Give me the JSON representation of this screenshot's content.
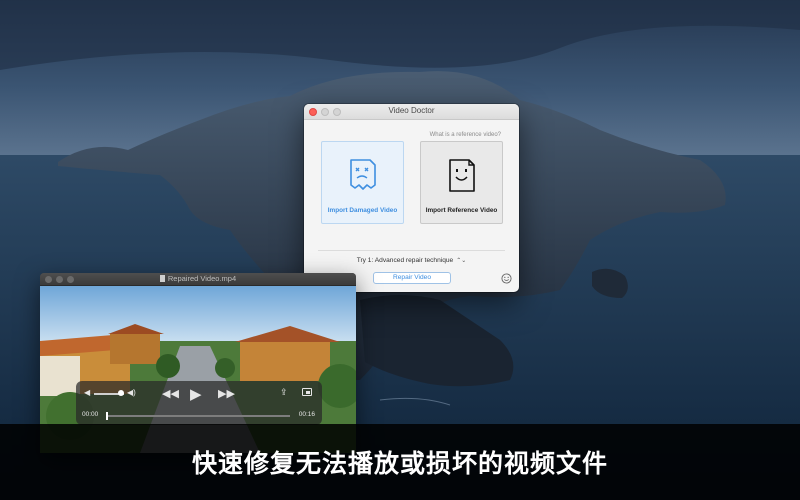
{
  "app_window": {
    "title": "Video Doctor",
    "help_link": "What is a reference video?",
    "damaged_card_label": "Import Damaged Video",
    "reference_card_label": "Import Reference Video",
    "technique_label": "Try 1: Advanced repair technique",
    "technique_chevron": "⌃⌄",
    "repair_button": "Repair Video"
  },
  "player_window": {
    "title": "Repaired Video.mp4",
    "current_time": "00:00",
    "duration": "00:16",
    "playback_progress": 0.0
  },
  "caption": "快速修复无法播放或损坏的视频文件",
  "colors": {
    "accent": "#3d8ee0",
    "close": "#fc5f57",
    "caption_bg": "#000000"
  },
  "icons": {
    "damaged": "sad-document-icon",
    "reference": "happy-document-icon",
    "feedback": "smiley-icon",
    "volume_min": "speaker-icon",
    "volume_max": "speaker-loud-icon",
    "rewind": "rewind-icon",
    "play": "play-icon",
    "fast_forward": "fast-forward-icon",
    "share": "share-icon",
    "pip": "picture-in-picture-icon"
  }
}
